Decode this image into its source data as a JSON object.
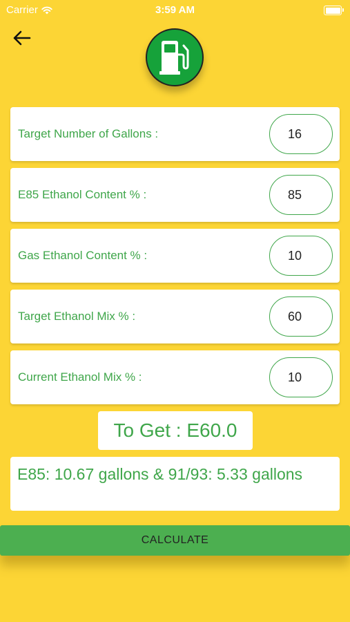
{
  "status_bar": {
    "carrier": "Carrier",
    "time": "3:59 AM"
  },
  "fields": [
    {
      "label": "Target Number of Gallons :",
      "value": "16"
    },
    {
      "label": "E85 Ethanol Content % :",
      "value": "85"
    },
    {
      "label": "Gas Ethanol Content % :",
      "value": "10"
    },
    {
      "label": "Target Ethanol Mix % :",
      "value": "60"
    },
    {
      "label": "Current Ethanol Mix % :",
      "value": "10"
    }
  ],
  "result": {
    "text": "To Get : E60.0"
  },
  "summary": {
    "text": "E85: 10.67 gallons & 91/93: 5.33 gallons"
  },
  "actions": {
    "calculate_label": "CALCULATE"
  },
  "colors": {
    "background": "#FCD535",
    "accent_green": "#3FA64A",
    "logo_green": "#16A23A",
    "button_green": "#4CAF50"
  },
  "icons": {
    "back": "arrow-left-icon",
    "logo": "fuel-pump-icon",
    "wifi": "wifi-icon",
    "battery": "battery-icon"
  }
}
